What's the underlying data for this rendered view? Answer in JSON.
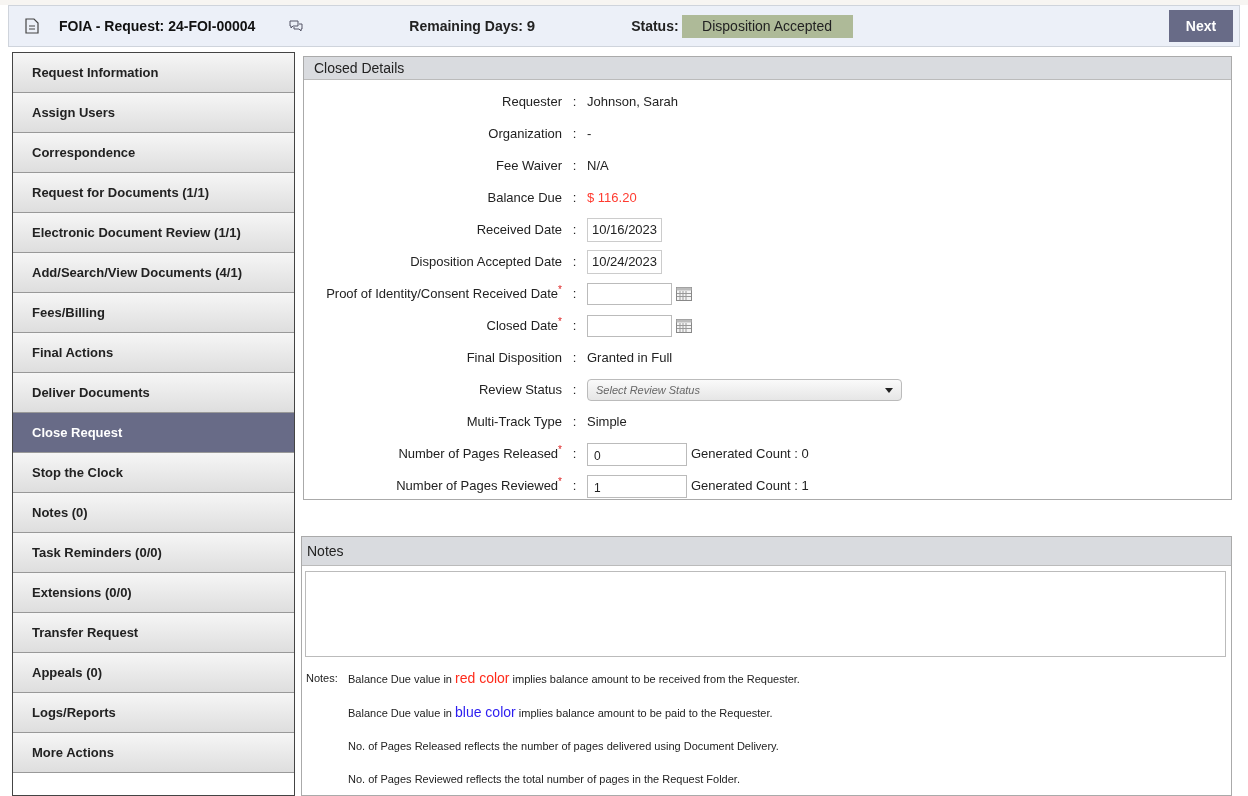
{
  "header": {
    "title": "FOIA - Request: 24-FOI-00004",
    "remaining_label": "Remaining Days:",
    "remaining_value": "9",
    "status_label": "Status:",
    "status_value": "Disposition Accepted",
    "next_button": "Next"
  },
  "sidebar": {
    "items": [
      {
        "label": "Request Information",
        "selected": false
      },
      {
        "label": "Assign Users",
        "selected": false
      },
      {
        "label": "Correspondence",
        "selected": false
      },
      {
        "label": "Request for Documents (1/1)",
        "selected": false
      },
      {
        "label": "Electronic Document Review (1/1)",
        "selected": false
      },
      {
        "label": "Add/Search/View Documents (4/1)",
        "selected": false
      },
      {
        "label": "Fees/Billing",
        "selected": false
      },
      {
        "label": "Final Actions",
        "selected": false
      },
      {
        "label": "Deliver Documents",
        "selected": false
      },
      {
        "label": "Close Request",
        "selected": true
      },
      {
        "label": "Stop the Clock",
        "selected": false
      },
      {
        "label": "Notes (0)",
        "selected": false
      },
      {
        "label": "Task Reminders (0/0)",
        "selected": false
      },
      {
        "label": "Extensions (0/0)",
        "selected": false
      },
      {
        "label": "Transfer Request",
        "selected": false
      },
      {
        "label": "Appeals (0)",
        "selected": false
      },
      {
        "label": "Logs/Reports",
        "selected": false
      },
      {
        "label": "More Actions",
        "selected": false
      }
    ]
  },
  "closed_details": {
    "title": "Closed Details",
    "rows": [
      {
        "kind": "text",
        "label": "Requester",
        "separator": ":",
        "value": "Johnson, Sarah"
      },
      {
        "kind": "text",
        "label": "Organization",
        "separator": ":",
        "value": "-"
      },
      {
        "kind": "text",
        "label": "Fee Waiver",
        "separator": ":",
        "value": "N/A"
      },
      {
        "kind": "amount",
        "label": "Balance Due",
        "separator": ":",
        "value": "$ 116.20",
        "color": "#ff3b30"
      },
      {
        "kind": "date_box",
        "label": "Received Date",
        "separator": ":",
        "value": "10/16/2023"
      },
      {
        "kind": "date_box",
        "label": "Disposition Accepted Date",
        "separator": ":",
        "value": "10/24/2023"
      },
      {
        "kind": "date_input",
        "label": "Proof of Identity/Consent Received Date",
        "mark": "*",
        "separator": ":"
      },
      {
        "kind": "date_input",
        "label": "Closed Date",
        "mark": "*",
        "separator": ":"
      },
      {
        "kind": "text",
        "label": "Final Disposition",
        "separator": ":",
        "value": "Granted in Full"
      },
      {
        "kind": "select",
        "label": "Review Status",
        "separator": ":",
        "placeholder": "Select Review Status"
      },
      {
        "kind": "text",
        "label": "Multi-Track Type",
        "separator": ":",
        "value": "Simple"
      },
      {
        "kind": "count",
        "label": "Number of Pages Released",
        "mark": "*",
        "separator": ":",
        "value": "0",
        "count": "Generated Count : 0"
      },
      {
        "kind": "count",
        "label": "Number of Pages Reviewed",
        "mark": "*",
        "separator": ":",
        "value": "1",
        "count": "Generated Count : 1"
      }
    ]
  },
  "notes": {
    "title": "Notes",
    "footnote_label": "Notes:",
    "footnotes": [
      {
        "before": "Balance Due value in ",
        "colored": "red color",
        "color": "#ff2a1a",
        "after": " implies balance amount to be received from the Requester."
      },
      {
        "before": "Balance Due value in ",
        "colored": "blue color",
        "color": "#2b1cf0",
        "after": " implies balance amount to be paid to the Requester."
      },
      {
        "before": "No. of Pages Released reflects the number of pages delivered using Document Delivery."
      },
      {
        "before": "No. of Pages Reviewed reflects the total number of pages in the Request Folder."
      }
    ]
  }
}
